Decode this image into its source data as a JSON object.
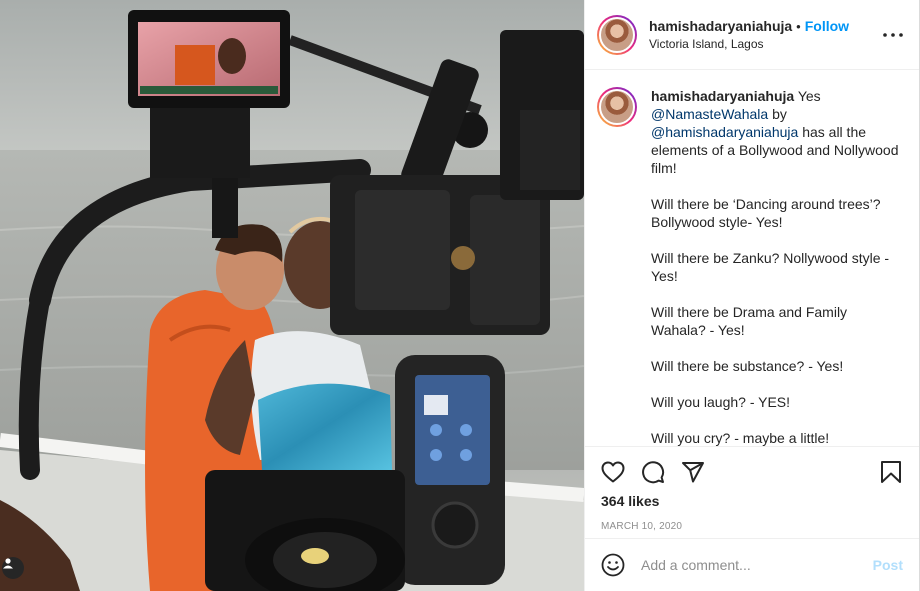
{
  "post": {
    "image_alt": "Film set on a beach with a camera rig framing a couple embracing",
    "username": "hamishadaryaniahuja",
    "follow_label": "Follow",
    "separator": "•",
    "location": "Victoria Island, Lagos",
    "caption": {
      "username": "hamishadaryaniahuja",
      "first_words": "Yes",
      "mention_1": "@NamasteWahala",
      "by": "by",
      "mention_2": "@hamishadaryaniahuja",
      "line_1_rest": "has all the elements of a Bollywood and Nollywood film!",
      "p2": "Will there be ‘Dancing around trees’? Bollywood style- Yes!",
      "p3": "Will there be Zanku? Nollywood style - Yes!",
      "p4": "Will there be Drama and Family Wahala? - Yes!",
      "p5": "Will there be substance? - Yes!",
      "p6": "Will you laugh? - YES!",
      "p7": "Will you cry? - maybe a little!"
    },
    "likes": "364 likes",
    "date": "MARCH 10, 2020",
    "comment_placeholder": "Add a comment...",
    "post_label": "Post"
  },
  "icons": {
    "more": "more-options-icon",
    "like": "heart-icon",
    "comment": "comment-icon",
    "share": "share-icon",
    "save": "bookmark-icon",
    "emoji": "emoji-icon",
    "tag": "user-tag-icon"
  },
  "colors": {
    "link_blue": "#0095f6",
    "mention_navy": "#00376b",
    "post_disabled": "#b2dffc",
    "muted": "#8e8e8e"
  }
}
